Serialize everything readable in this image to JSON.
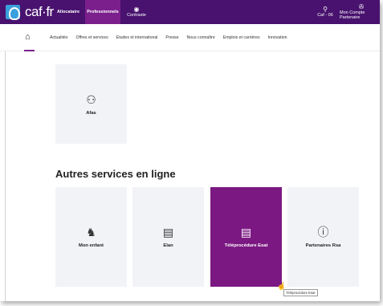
{
  "topbar": {
    "logo_text": "caf·fr",
    "nav": {
      "allocataire": "Allocataire",
      "professionnels": "Professionnels",
      "contraste": "Contraste",
      "caf": "Caf - 06",
      "compte": "Mon Compte Partenaire"
    },
    "icons": {
      "contraste": "eye-icon",
      "caf": "location-pin-icon",
      "compte": "handshake-icon"
    },
    "colors": {
      "bar": "#48126e",
      "active_tab": "#7b1f8d"
    }
  },
  "subnav": {
    "home_icon": "home-icon",
    "items": [
      "Actualités",
      "Offres et services",
      "Etudes et international",
      "Presse",
      "Nous connaître",
      "Emplois et carrières",
      "Innovation"
    ]
  },
  "main": {
    "top_card": {
      "label": "Afas",
      "icon": "network-person-icon"
    },
    "section_title": "Autres services en ligne",
    "services": [
      {
        "label": "Mon enfant",
        "icon": "rocking-horse-icon",
        "active": false
      },
      {
        "label": "Elan",
        "icon": "document-icon",
        "active": false
      },
      {
        "label": "Téléprocédure Esat",
        "icon": "form-icon",
        "active": true
      },
      {
        "label": "Partenaires Rsa",
        "icon": "info-icon",
        "active": false
      }
    ],
    "tooltip": "Téléprocédure Esat",
    "colors": {
      "card_bg": "#f2f3f7",
      "card_active": "#7b1882"
    }
  }
}
